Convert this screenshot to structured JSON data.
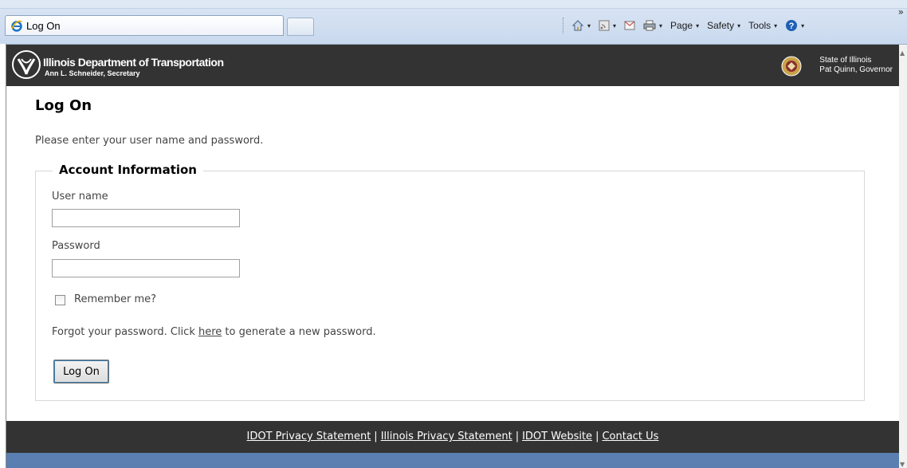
{
  "browser": {
    "tab_title": "Log On",
    "commands": {
      "home_caret": "▾",
      "feeds_caret": "▾",
      "print_caret": "▾",
      "page": "Page",
      "safety": "Safety",
      "tools": "Tools",
      "help_caret": "▾",
      "overflow": "»"
    }
  },
  "header": {
    "org_name": "Illinois Department of Transportation",
    "secretary": "Ann L. Schneider, Secretary",
    "state_line1": "State of Illinois",
    "state_line2": "Pat Quinn, Governor"
  },
  "main": {
    "title": "Log On",
    "intro": "Please enter your user name and password.",
    "fieldset_legend": "Account Information",
    "username_label": "User name",
    "username_value": "",
    "password_label": "Password",
    "password_value": "",
    "remember_label": "Remember me?",
    "remember_checked": false,
    "forgot_prefix": "Forgot your password. Click ",
    "forgot_link": "here",
    "forgot_suffix": " to generate a new password.",
    "submit_label": "Log On"
  },
  "footer": {
    "links": [
      "IDOT Privacy Statement",
      "Illinois Privacy Statement",
      "IDOT Website",
      "Contact Us"
    ],
    "separator": "|"
  },
  "colors": {
    "header_bg": "#333333",
    "footer_bg": "#333333",
    "bottom_bar": "#5a7fb0",
    "link": "#444444"
  },
  "icons": [
    "ie-icon",
    "home-icon",
    "feeds-icon",
    "mail-icon",
    "print-icon",
    "help-icon",
    "idot-logo-icon",
    "illinois-seal-icon"
  ]
}
